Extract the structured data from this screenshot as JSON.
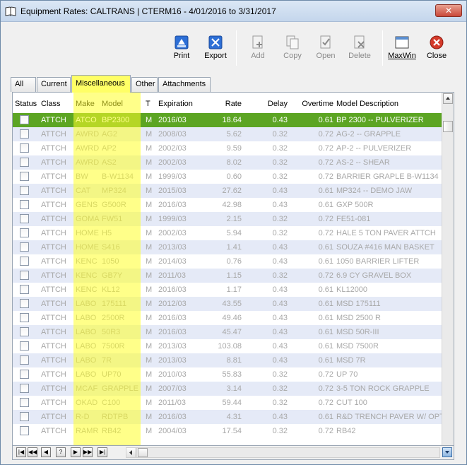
{
  "window": {
    "title": "Equipment Rates: CALTRANS | CTERM16 -  4/01/2016 to  3/31/2017",
    "close_glyph": "✕"
  },
  "toolbar": {
    "print": "Print",
    "export": "Export",
    "add": "Add",
    "copy": "Copy",
    "open": "Open",
    "delete": "Delete",
    "maxwin": "MaxWin",
    "close": "Close"
  },
  "tabs": [
    "All",
    "Current",
    "Miscellaneous",
    "Other",
    "Attachments"
  ],
  "active_tab": "Miscellaneous",
  "columns": {
    "status": "Status",
    "class": "Class",
    "make": "Make",
    "model": "Model",
    "t": "T",
    "expiration": "Expiration",
    "rate": "Rate",
    "delay": "Delay",
    "overtime": "Overtime",
    "description": "Model Description"
  },
  "rows": [
    {
      "class": "ATTCH",
      "make": "ATCO",
      "model": "BP2300",
      "t": "M",
      "expiration": "2016/03",
      "rate": "18.64",
      "delay": "0.43",
      "overtime": "0.61",
      "description": "BP 2300 -- PULVERIZER"
    },
    {
      "class": "ATTCH",
      "make": "AWRD",
      "model": "AG2",
      "t": "M",
      "expiration": "2008/03",
      "rate": "5.62",
      "delay": "0.32",
      "overtime": "0.72",
      "description": "AG-2 -- GRAPPLE"
    },
    {
      "class": "ATTCH",
      "make": "AWRD",
      "model": "AP2",
      "t": "M",
      "expiration": "2002/03",
      "rate": "9.59",
      "delay": "0.32",
      "overtime": "0.72",
      "description": "AP-2 -- PULVERIZER"
    },
    {
      "class": "ATTCH",
      "make": "AWRD",
      "model": "AS2",
      "t": "M",
      "expiration": "2002/03",
      "rate": "8.02",
      "delay": "0.32",
      "overtime": "0.72",
      "description": "AS-2 -- SHEAR"
    },
    {
      "class": "ATTCH",
      "make": "BW",
      "model": "B-W1134",
      "t": "M",
      "expiration": "1999/03",
      "rate": "0.60",
      "delay": "0.32",
      "overtime": "0.72",
      "description": "BARRIER GRAPLE B-W1134"
    },
    {
      "class": "ATTCH",
      "make": "CAT",
      "model": "MP324",
      "t": "M",
      "expiration": "2015/03",
      "rate": "27.62",
      "delay": "0.43",
      "overtime": "0.61",
      "description": "MP324 -- DEMO JAW"
    },
    {
      "class": "ATTCH",
      "make": "GENS",
      "model": "G500R",
      "t": "M",
      "expiration": "2016/03",
      "rate": "42.98",
      "delay": "0.43",
      "overtime": "0.61",
      "description": "GXP 500R"
    },
    {
      "class": "ATTCH",
      "make": "GOMA",
      "model": "FW51",
      "t": "M",
      "expiration": "1999/03",
      "rate": "2.15",
      "delay": "0.32",
      "overtime": "0.72",
      "description": "FE51-081"
    },
    {
      "class": "ATTCH",
      "make": "HOME",
      "model": "H5",
      "t": "M",
      "expiration": "2002/03",
      "rate": "5.94",
      "delay": "0.32",
      "overtime": "0.72",
      "description": "HALE 5 TON PAVER ATTCH"
    },
    {
      "class": "ATTCH",
      "make": "HOME",
      "model": "S416",
      "t": "M",
      "expiration": "2013/03",
      "rate": "1.41",
      "delay": "0.43",
      "overtime": "0.61",
      "description": "SOUZA #416 MAN BASKET"
    },
    {
      "class": "ATTCH",
      "make": "KENC",
      "model": "1050",
      "t": "M",
      "expiration": "2014/03",
      "rate": "0.76",
      "delay": "0.43",
      "overtime": "0.61",
      "description": "1050 BARRIER LIFTER"
    },
    {
      "class": "ATTCH",
      "make": "KENC",
      "model": "GB7Y",
      "t": "M",
      "expiration": "2011/03",
      "rate": "1.15",
      "delay": "0.32",
      "overtime": "0.72",
      "description": "6.9 CY GRAVEL BOX"
    },
    {
      "class": "ATTCH",
      "make": "KENC",
      "model": "KL12",
      "t": "M",
      "expiration": "2016/03",
      "rate": "1.17",
      "delay": "0.43",
      "overtime": "0.61",
      "description": "KL12000"
    },
    {
      "class": "ATTCH",
      "make": "LABO",
      "model": "175111",
      "t": "M",
      "expiration": "2012/03",
      "rate": "43.55",
      "delay": "0.43",
      "overtime": "0.61",
      "description": "MSD 175111"
    },
    {
      "class": "ATTCH",
      "make": "LABO",
      "model": "2500R",
      "t": "M",
      "expiration": "2016/03",
      "rate": "49.46",
      "delay": "0.43",
      "overtime": "0.61",
      "description": "MSD 2500 R"
    },
    {
      "class": "ATTCH",
      "make": "LABO",
      "model": "50R3",
      "t": "M",
      "expiration": "2016/03",
      "rate": "45.47",
      "delay": "0.43",
      "overtime": "0.61",
      "description": "MSD 50R-III"
    },
    {
      "class": "ATTCH",
      "make": "LABO",
      "model": "7500R",
      "t": "M",
      "expiration": "2013/03",
      "rate": "103.08",
      "delay": "0.43",
      "overtime": "0.61",
      "description": "MSD 7500R"
    },
    {
      "class": "ATTCH",
      "make": "LABO",
      "model": "7R",
      "t": "M",
      "expiration": "2013/03",
      "rate": "8.81",
      "delay": "0.43",
      "overtime": "0.61",
      "description": "MSD 7R"
    },
    {
      "class": "ATTCH",
      "make": "LABO",
      "model": "UP70",
      "t": "M",
      "expiration": "2010/03",
      "rate": "55.83",
      "delay": "0.32",
      "overtime": "0.72",
      "description": "UP 70"
    },
    {
      "class": "ATTCH",
      "make": "MCAF",
      "model": "GRAPPLE",
      "t": "M",
      "expiration": "2007/03",
      "rate": "3.14",
      "delay": "0.32",
      "overtime": "0.72",
      "description": "3-5 TON ROCK GRAPPLE"
    },
    {
      "class": "ATTCH",
      "make": "OKAD",
      "model": "C100",
      "t": "M",
      "expiration": "2011/03",
      "rate": "59.44",
      "delay": "0.32",
      "overtime": "0.72",
      "description": "CUT 100"
    },
    {
      "class": "ATTCH",
      "make": "R-D",
      "model": "RDTPB",
      "t": "M",
      "expiration": "2016/03",
      "rate": "4.31",
      "delay": "0.43",
      "overtime": "0.61",
      "description": "R&D TRENCH PAVER W/ OPT"
    },
    {
      "class": "ATTCH",
      "make": "RAMR",
      "model": "RB42",
      "t": "M",
      "expiration": "2004/03",
      "rate": "17.54",
      "delay": "0.32",
      "overtime": "0.72",
      "description": "RB42"
    }
  ],
  "selected_row": 0,
  "nav": [
    "|◀",
    "◀◀",
    "◀",
    "?",
    "▶",
    "▶▶",
    "▶|"
  ],
  "colors": {
    "selected_row": "#5ca523",
    "highlight_columns": "#ffff28",
    "alt_row": "#e5eaf7"
  }
}
